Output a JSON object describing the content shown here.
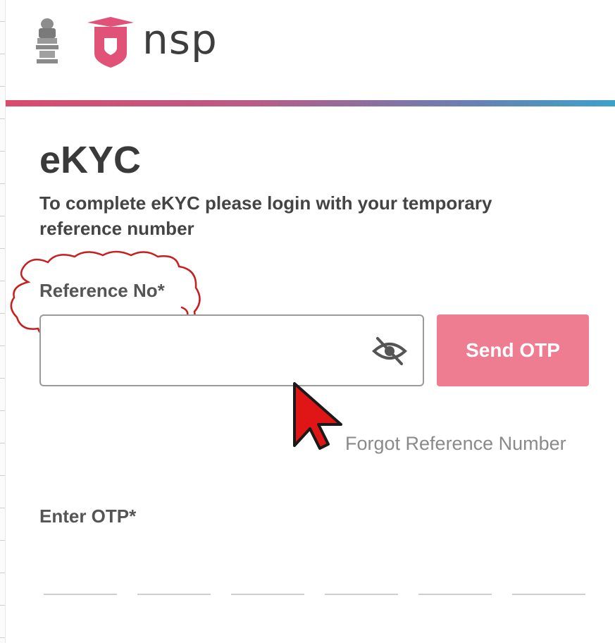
{
  "header": {
    "emblem_icon": "national-emblem-icon",
    "logo_icon": "nsp-shield-logo-icon",
    "logo_text": "nsp",
    "logo_color": "#e05277",
    "accent_gradient": [
      "#d94b6c",
      "#3ea1c9"
    ]
  },
  "main": {
    "title": "eKYC",
    "subtitle": "To complete eKYC please login with your temporary reference number",
    "reference_field": {
      "label": "Reference No*",
      "value": "",
      "placeholder": "",
      "toggle_icon": "eye-off-icon"
    },
    "send_otp_label": "Send OTP",
    "send_otp_color": "#ef7d92",
    "forgot_link": "Forgot Reference Number",
    "otp_field": {
      "label": "Enter OTP*",
      "digits": [
        "",
        "",
        "",
        "",
        "",
        ""
      ]
    }
  },
  "annotations": {
    "highlight": "red-cloud-annotation",
    "pointer": "red-cursor-icon",
    "color": "#c81e1e"
  }
}
